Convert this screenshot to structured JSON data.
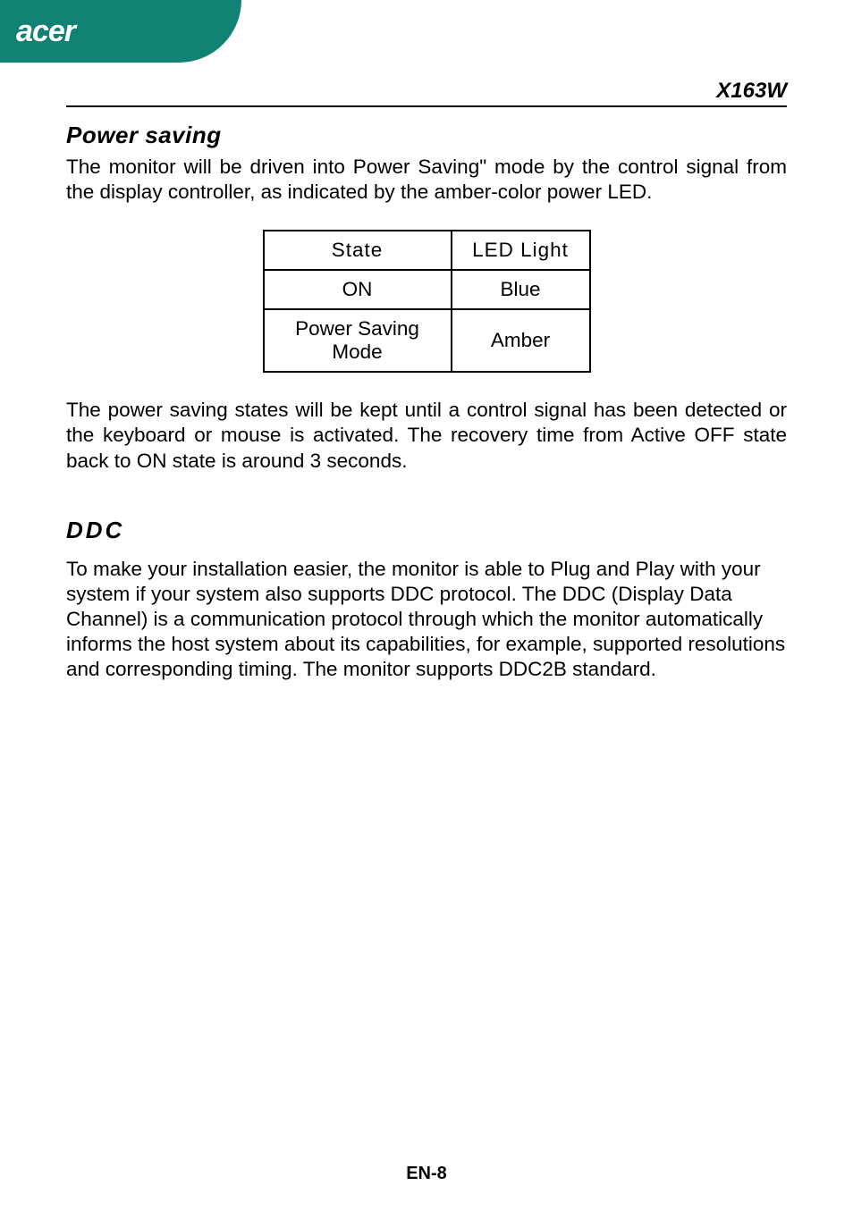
{
  "brand": {
    "logo_text": "acer"
  },
  "model": "X163W",
  "sections": {
    "power_saving": {
      "heading": "Power saving",
      "intro": "The monitor will be driven into Power Saving\" mode by the control signal from the display controller, as indicated by the amber-color power LED.",
      "table": {
        "headers": {
          "state": "State",
          "led": "LED Light"
        },
        "rows": [
          {
            "state": "ON",
            "led": "Blue"
          },
          {
            "state": "Power Saving Mode",
            "led": "Amber"
          }
        ]
      },
      "outro": "The power saving states will be kept until a control signal has been detected or the keyboard or mouse is activated. The recovery time from Active OFF state back to ON state is around 3 seconds."
    },
    "ddc": {
      "heading": "DDC",
      "body": "To make your installation easier, the monitor is able to Plug and Play with your system if your system also supports DDC protocol. The DDC (Display Data Channel) is a communication protocol through which the monitor automatically informs the host system  about its capabilities, for example, supported resolutions and corresponding timing. The monitor supports DDC2B standard."
    }
  },
  "page_number": "EN-8"
}
